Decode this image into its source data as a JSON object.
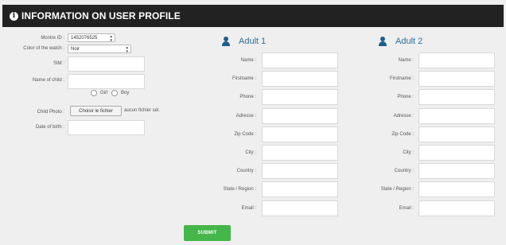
{
  "header": {
    "title": "INFORMATION ON USER PROFILE"
  },
  "left": {
    "montre_id": {
      "label": "Montre ID :",
      "value": "1452076525"
    },
    "color": {
      "label": "Color of the watch :",
      "value": "Noir"
    },
    "sim": {
      "label": "SIM :",
      "value": ""
    },
    "child_name": {
      "label": "Name of child :",
      "value": ""
    },
    "gender": {
      "options": [
        "Girl",
        "Boy"
      ]
    },
    "photo": {
      "label": "Child Photo :",
      "button": "Choisir le fichier",
      "status": "aucun fichier sél."
    },
    "dob": {
      "label": "Date of birth :",
      "value": ""
    }
  },
  "adult1": {
    "title": "Adult 1",
    "fields": [
      "Name :",
      "Firstname :",
      "Phone :",
      "Adresse :",
      "Zip Code :",
      "City :",
      "Country :",
      "State / Region :",
      "Email :"
    ]
  },
  "adult2": {
    "title": "Adult 2",
    "fields": [
      "Name :",
      "Firstname :",
      "Phone :",
      "Adresse :",
      "Zip Code :",
      "City :",
      "Country :",
      "State / Region :",
      "Email :"
    ]
  },
  "submit": {
    "label": "SUBMIT"
  },
  "colors": {
    "header_bg": "#222222",
    "accent_blue": "#2a6f9c",
    "submit_green": "#45b649"
  }
}
